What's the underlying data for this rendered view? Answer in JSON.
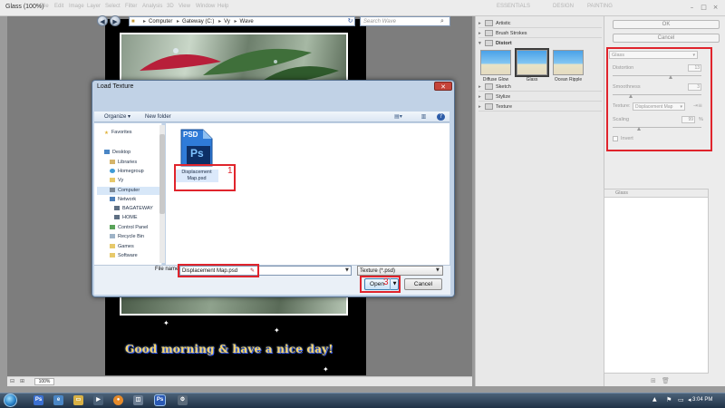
{
  "app": {
    "title": "Glass (100%)",
    "menus": [
      "File",
      "Edit",
      "Image",
      "Layer",
      "Select",
      "Filter",
      "Analysis",
      "3D",
      "View",
      "Window",
      "Help"
    ],
    "workspace_tabs": [
      "ESSENTIALS",
      "DESIGN",
      "PAINTING"
    ]
  },
  "canvas": {
    "image_caption": "Good morning & have a nice day!",
    "zoom": "100%"
  },
  "filter_gallery": {
    "folders": [
      {
        "label": "Artistic",
        "expanded": false
      },
      {
        "label": "Brush Strokes",
        "expanded": false
      },
      {
        "label": "Distort",
        "expanded": true
      },
      {
        "label": "Sketch",
        "expanded": false
      },
      {
        "label": "Stylize",
        "expanded": false
      },
      {
        "label": "Texture",
        "expanded": false
      }
    ],
    "distort_thumbs": [
      "Diffuse Glow",
      "Glass",
      "Ocean Ripple"
    ],
    "ok_label": "OK",
    "cancel_label": "Cancel",
    "filter_select": "Glass",
    "distortion": {
      "label": "Distortion",
      "value": "13",
      "level": 0.65
    },
    "smoothness": {
      "label": "Smoothness",
      "value": "3",
      "level": 0.2
    },
    "texture": {
      "label": "Texture:",
      "value": "Displacement Map"
    },
    "scaling": {
      "label": "Scaling",
      "value": "99",
      "unit": "%",
      "level": 0.3
    },
    "invert_label": "Invert",
    "layer_name": "Glass"
  },
  "dialog": {
    "title": "Load Texture",
    "breadcrumb": [
      "Computer",
      "Gateway (C:)",
      "Vy",
      "Wave"
    ],
    "search_placeholder": "Search Wave",
    "organize_label": "Organize",
    "new_folder_label": "New folder",
    "nav": {
      "favorites": "Favorites",
      "desktop": "Desktop",
      "libraries": "Libraries",
      "homegroup": "Homegroup",
      "vy": "Vy",
      "computer": "Computer",
      "network": "Network",
      "bagateway": "BAGATEWAY",
      "home": "HOME",
      "control_panel": "Control Panel",
      "recycle_bin": "Recycle Bin",
      "games": "Games",
      "software": "Software"
    },
    "file": {
      "name": "Displacement Map.psd",
      "icon_badge": "PSD",
      "icon_glyph": "Ps"
    },
    "file_name_label": "File name:",
    "file_name_value": "Displacement Map.psd",
    "file_type": "Texture (*.psd)",
    "open_label": "Open",
    "cancel_label": "Cancel"
  },
  "annotations": {
    "step1": "1",
    "step3": "3"
  },
  "taskbar": {
    "time": "3:04 PM"
  },
  "colors": {
    "annotation_red": "#e0242c",
    "dialog_frame": "#c1d2e6",
    "ps_blue": "#1c6fcf"
  }
}
